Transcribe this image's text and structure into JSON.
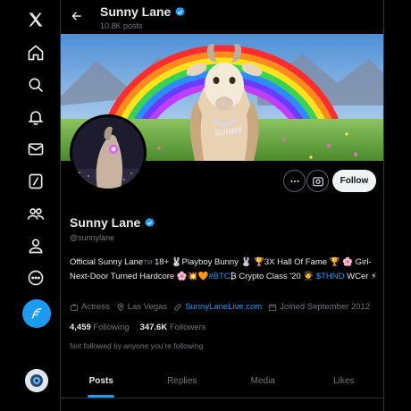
{
  "nav": {
    "items": [
      {
        "icon": "x-logo-icon"
      },
      {
        "icon": "home-icon"
      },
      {
        "icon": "search-icon"
      },
      {
        "icon": "bell-icon"
      },
      {
        "icon": "mail-icon"
      },
      {
        "icon": "grok-icon"
      },
      {
        "icon": "communities-icon"
      },
      {
        "icon": "profile-icon"
      },
      {
        "icon": "more-icon"
      }
    ],
    "post_icon": "feather-icon",
    "account_avatar": "account-avatar"
  },
  "header": {
    "name": "Sunny Lane",
    "post_count": "10.8K posts"
  },
  "actions": {
    "follow_label": "Follow"
  },
  "profile": {
    "name": "Sunny Lane",
    "handle": "@sunnylane",
    "bio": {
      "part1": "Official Sunny Lane",
      "tm": "TM",
      "part2": " 18+ 🐰Playboy Bunny 🐰 🏆3X Hall Of Fame 🏆 🌸 Girl-Next-Door Turned Hardcore 🌸💥🧡",
      "hashtag": "#BTC",
      "part3": "₿ Crypto Class '20 🧑‍🎓 ",
      "cashtag": "$THND",
      "part4": " WCer ⚡"
    },
    "profession": "Actress",
    "location": "Las Vegas",
    "website": "SunnyLaneLive.com",
    "joined": "Joined September 2012",
    "following_count": "4,459",
    "following_label": "Following",
    "followers_count": "347.6K",
    "followers_label": "Followers",
    "not_followed": "Not followed by anyone you’re following"
  },
  "tabs": [
    {
      "label": "Posts",
      "active": true
    },
    {
      "label": "Replies",
      "active": false
    },
    {
      "label": "Media",
      "active": false
    },
    {
      "label": "Likes",
      "active": false
    }
  ],
  "colors": {
    "accent": "#1d9bf0",
    "background": "#000000",
    "text": "#e7e9ea",
    "muted": "#71767b"
  }
}
